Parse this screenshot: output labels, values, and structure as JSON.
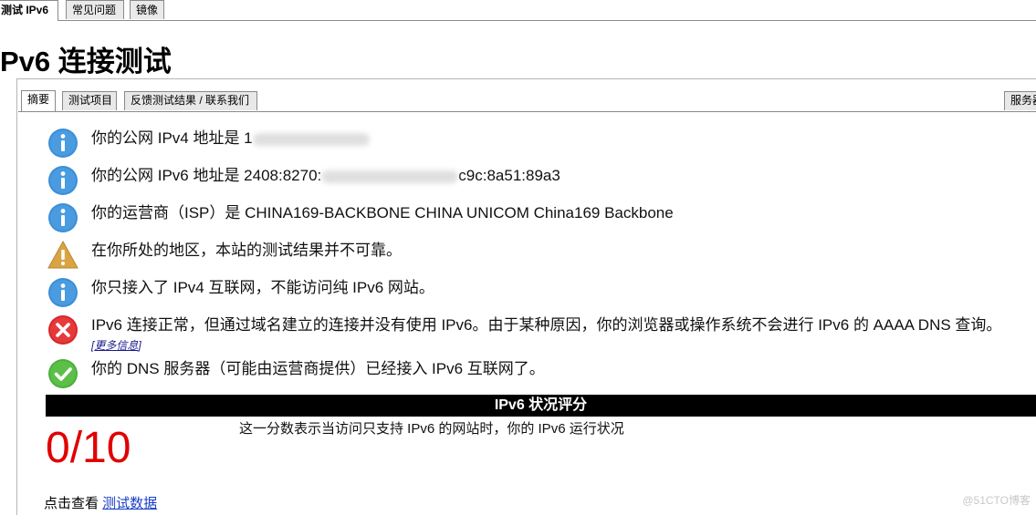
{
  "top_tabs": [
    {
      "label": "测试 IPv6",
      "active": true
    },
    {
      "label": "常见问题",
      "active": false
    },
    {
      "label": "镜像",
      "active": false
    }
  ],
  "page_title": "Pv6 连接测试",
  "inner_tabs": [
    {
      "label": "摘要",
      "active": true
    },
    {
      "label": "测试项目",
      "active": false
    },
    {
      "label": "反馈测试结果 / 联系我们",
      "active": false
    },
    {
      "label": "服务器",
      "active": false
    }
  ],
  "messages": [
    {
      "icon": "info-icon",
      "text": "你的公网 IPv4 地址是 1",
      "tail": ""
    },
    {
      "icon": "info-icon",
      "text": "你的公网 IPv6 地址是 2408:8270:",
      "tail": "c9c:8a51:89a3"
    },
    {
      "icon": "info-icon",
      "text": "你的运营商（ISP）是 CHINA169-BACKBONE CHINA UNICOM China169 Backbone"
    },
    {
      "icon": "warning-icon",
      "text": "在你所处的地区，本站的测试结果并不可靠。"
    },
    {
      "icon": "info-icon",
      "text": "你只接入了 IPv4 互联网，不能访问纯 IPv6 网站。"
    },
    {
      "icon": "error-icon",
      "text": "IPv6 连接正常，但通过域名建立的连接并没有使用 IPv6。由于某种原因，你的浏览器或操作系统不会进行 IPv6 的 AAAA DNS 查询。"
    },
    {
      "icon": "check-icon",
      "text": "你的 DNS 服务器（可能由运营商提供）已经接入 IPv6 互联网了。"
    }
  ],
  "more_info": {
    "open": "[",
    "label": "更多信息",
    "close": "]"
  },
  "score": {
    "header": "IPv6 状况评分",
    "value": "0/10",
    "description": "这一分数表示当访问只支持 IPv6 的网站时，你的 IPv6 运行状况"
  },
  "footer": {
    "prefix": "点击查看 ",
    "link": "测试数据"
  },
  "watermark": "@51CTO博客",
  "colors": {
    "info": "#3b8fd8",
    "warning": "#d9a441",
    "error": "#d9262a",
    "success": "#4caf3c",
    "score": "#e00000"
  }
}
